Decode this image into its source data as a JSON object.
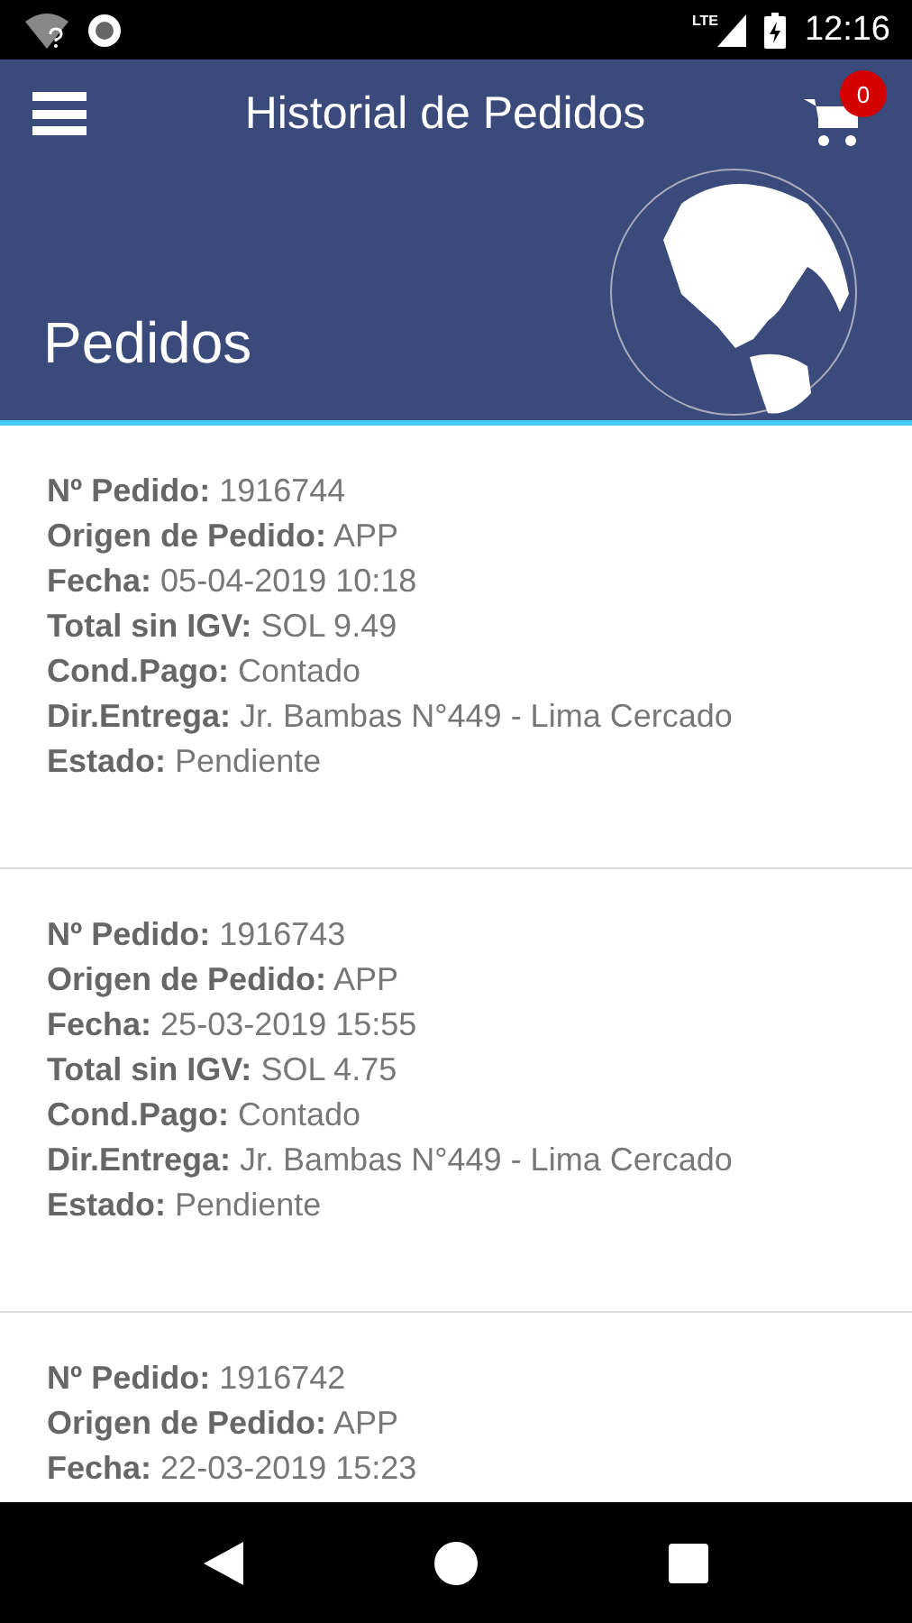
{
  "status_bar": {
    "network": "LTE",
    "time": "12:16"
  },
  "app_bar": {
    "title": "Historial de Pedidos",
    "cart_count": "0"
  },
  "header": {
    "title": "Pedidos"
  },
  "orders": [
    {
      "fields": [
        {
          "label": "Nº Pedido:",
          "value": "1916744"
        },
        {
          "label": "Origen de Pedido:",
          "value": "APP"
        },
        {
          "label": "Fecha:",
          "value": "05-04-2019 10:18"
        },
        {
          "label": "Total sin IGV:",
          "value": "SOL 9.49"
        },
        {
          "label": "Cond.Pago:",
          "value": "Contado"
        },
        {
          "label": "Dir.Entrega:",
          "value": "Jr. Bambas N°449 - Lima Cercado"
        },
        {
          "label": "Estado:",
          "value": "Pendiente"
        }
      ]
    },
    {
      "fields": [
        {
          "label": "Nº Pedido:",
          "value": "1916743"
        },
        {
          "label": "Origen de Pedido:",
          "value": "APP"
        },
        {
          "label": "Fecha:",
          "value": "25-03-2019 15:55"
        },
        {
          "label": "Total sin IGV:",
          "value": "SOL 4.75"
        },
        {
          "label": "Cond.Pago:",
          "value": "Contado"
        },
        {
          "label": "Dir.Entrega:",
          "value": "Jr. Bambas N°449 - Lima Cercado"
        },
        {
          "label": "Estado:",
          "value": "Pendiente"
        }
      ]
    },
    {
      "fields": [
        {
          "label": "Nº Pedido:",
          "value": "1916742"
        },
        {
          "label": "Origen de Pedido:",
          "value": "APP"
        },
        {
          "label": "Fecha:",
          "value": "22-03-2019 15:23"
        }
      ]
    }
  ]
}
